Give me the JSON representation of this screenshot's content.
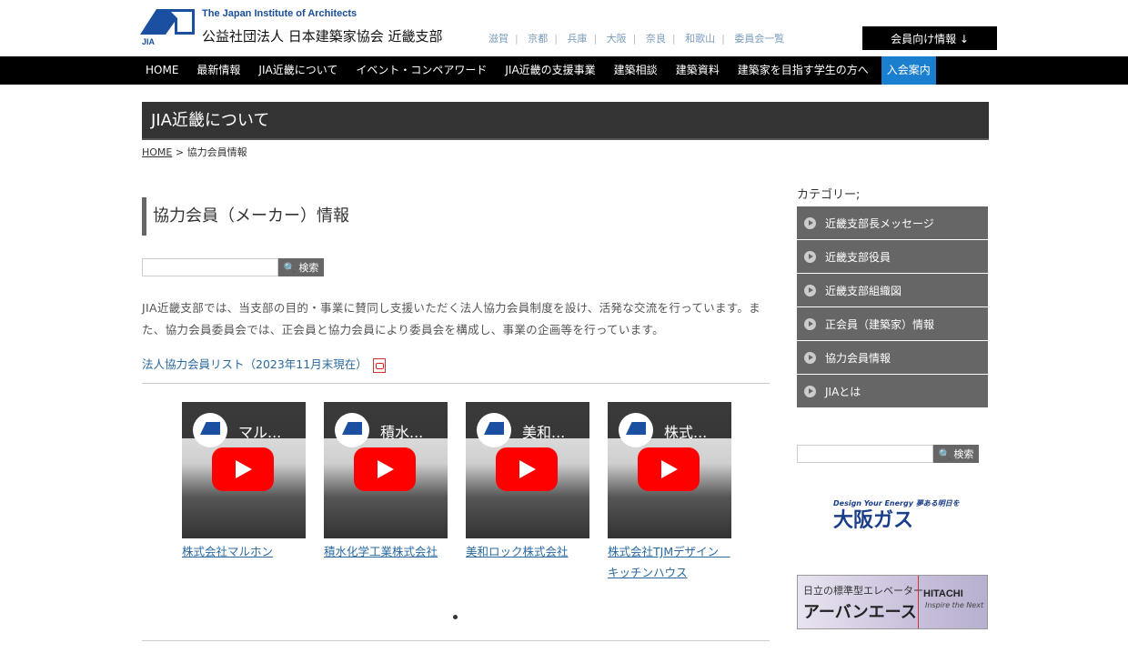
{
  "header": {
    "org_en": "The Japan Institute of Architects",
    "org_ja": "公益社団法人 日本建築家協会 近畿支部",
    "logo_text": "JIA",
    "cities": [
      "滋賀",
      "京都",
      "兵庫",
      "大阪",
      "奈良",
      "和歌山",
      "委員会一覧"
    ],
    "member_button": "会員向け情報 ↓"
  },
  "nav": {
    "items": [
      "HOME",
      "最新情報",
      "JIA近畿について",
      "イベント・コンペアワード",
      "JIA近畿の支援事業",
      "建築相談",
      "建築資料",
      "建築家を目指す学生の方へ"
    ],
    "join": "入会案内",
    "join_color": "#1b7fd0"
  },
  "page": {
    "section_title": "JIA近畿について",
    "breadcrumb_home": "HOME",
    "breadcrumb_sep": ">",
    "breadcrumb_current": "協力会員情報",
    "heading": "協力会員（メーカー）情報",
    "search_button": "検索",
    "intro": "JIA近畿支部では、当支部の目的・事業に賛同し支援いただく法人協力会員制度を設け、活発な交流を行っています。また、協力会員委員会では、正会員と協力会員により委員会を構成し、事業の企画等を行っています。",
    "pdf_link": "法人協力会員リスト（2023年11月末現在）"
  },
  "videos": [
    {
      "thumb_title": "マル...",
      "label": "株式会社マルホン"
    },
    {
      "thumb_title": "積水...",
      "label": "積水化学工業株式会社"
    },
    {
      "thumb_title": "美和...",
      "label": "美和ロック株式会社"
    },
    {
      "thumb_title": "株式...",
      "label": "株式会社TJMデザイン　キッチンハウス"
    }
  ],
  "sidebar": {
    "category_title": "カテゴリー;",
    "categories": [
      "近畿支部長メッセージ",
      "近畿支部役員",
      "近畿支部組織図",
      "正会員（建築家）情報",
      "協力会員情報",
      "JIAとは"
    ],
    "search_button": "検索",
    "ad1_tag": "Design Your Energy 夢ある明日を",
    "ad1_name": "大阪ガス",
    "ad2_line1": "日立の標準型エレベーター",
    "ad2_line2": "アーバンエース",
    "ad2_brand": "HITACHI",
    "ad2_tagline": "Inspire the Next"
  }
}
